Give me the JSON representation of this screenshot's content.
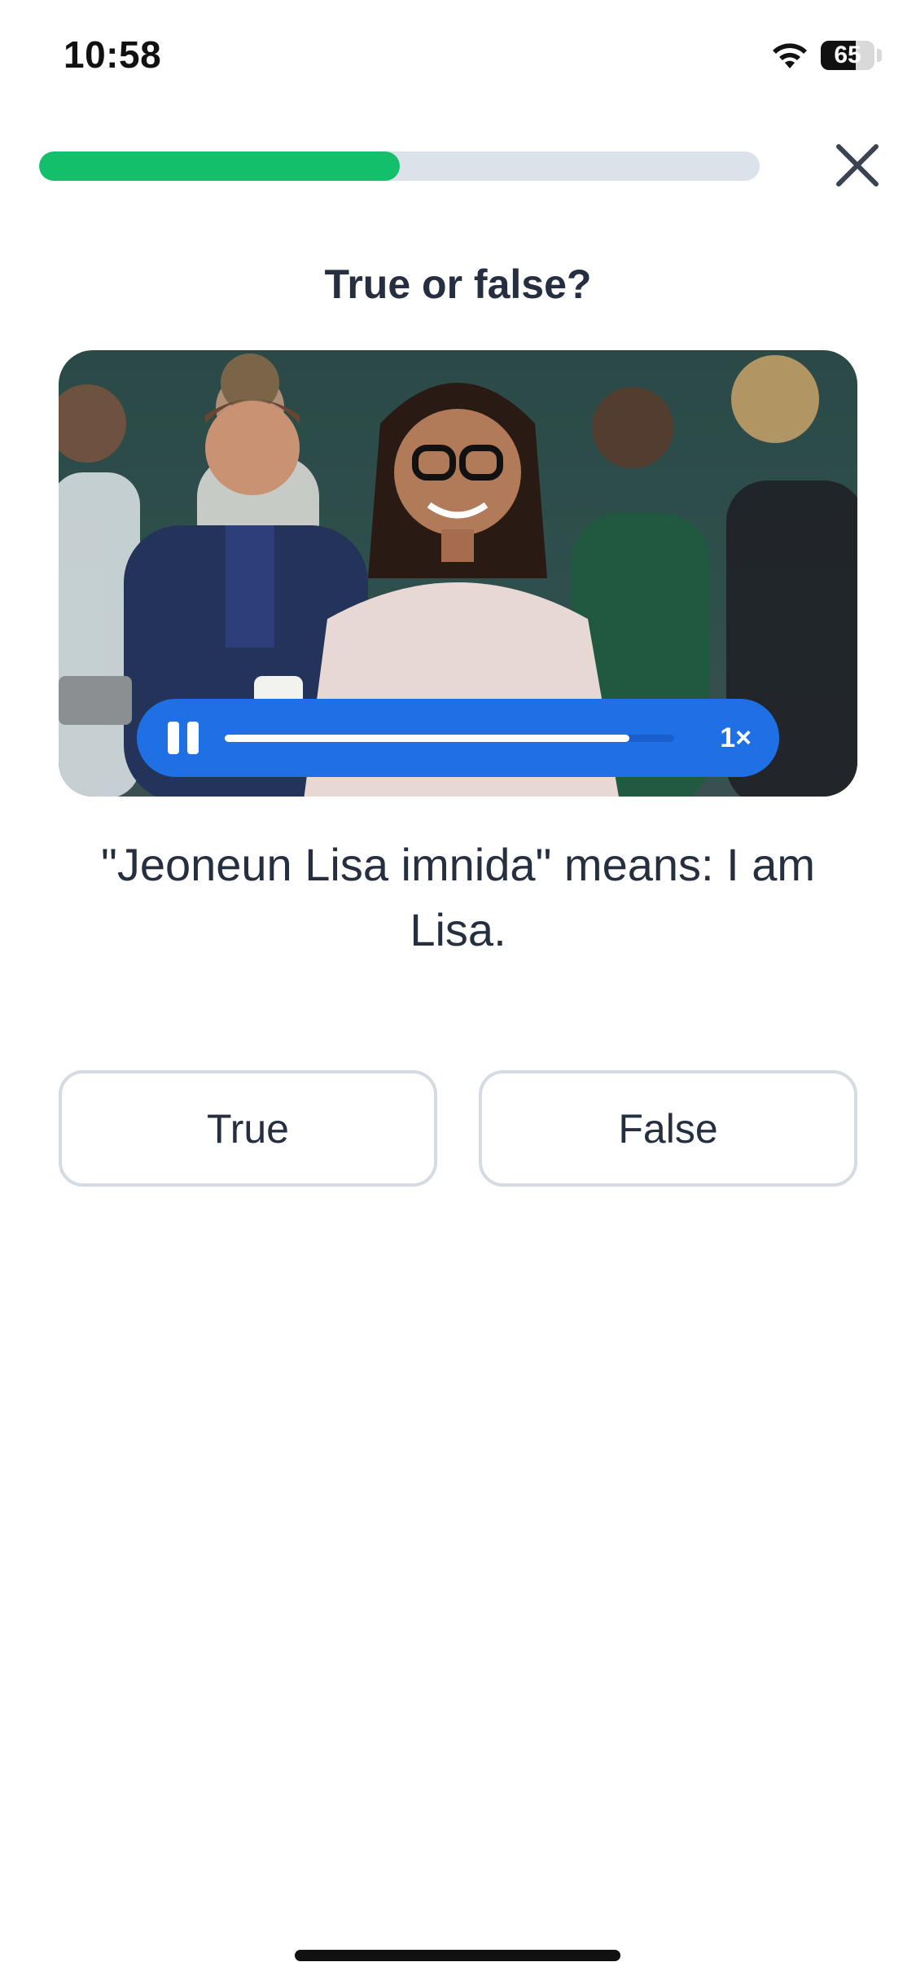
{
  "status_bar": {
    "time": "10:58",
    "battery_level": "65",
    "wifi_icon": "wifi-icon"
  },
  "lesson": {
    "progress_fraction": 0.5,
    "close_icon": "close-icon"
  },
  "question": {
    "title": "True or false?",
    "statement": "\"Jeoneun Lisa imnida\" means: I am Lisa."
  },
  "media": {
    "content": "photo of a smiling group of people",
    "player": {
      "state": "playing",
      "pause_icon": "pause-icon",
      "progress_fraction": 0.9,
      "speed_label": "1×"
    }
  },
  "answers": {
    "true_label": "True",
    "false_label": "False"
  },
  "colors": {
    "progress": "#14bf6b",
    "player": "#1f6fe5",
    "text": "#252f3f",
    "option_border": "#d4dbe3"
  }
}
